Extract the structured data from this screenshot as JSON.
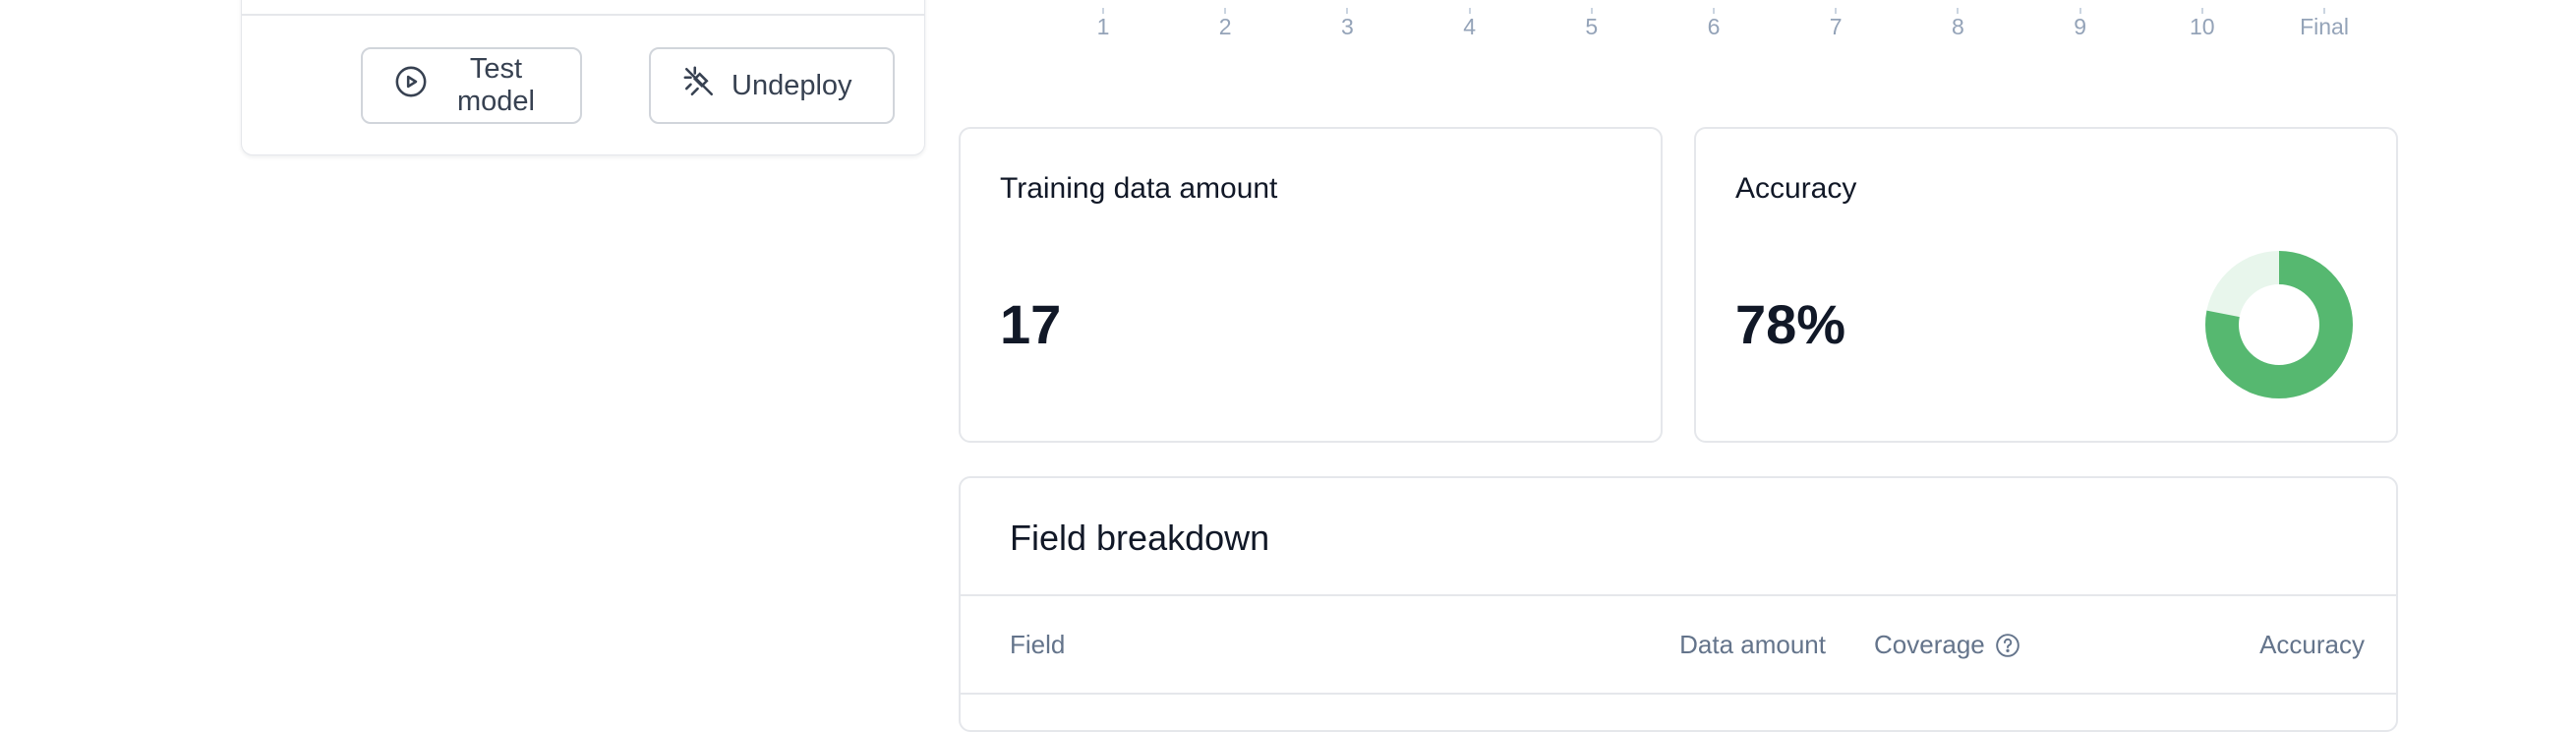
{
  "actions": {
    "test_model_label": "Test model",
    "undeploy_label": "Undeploy"
  },
  "xaxis": {
    "ticks": [
      "1",
      "2",
      "3",
      "4",
      "5",
      "6",
      "7",
      "8",
      "9",
      "10",
      "Final"
    ]
  },
  "stats": {
    "training": {
      "title": "Training data amount",
      "value": "17"
    },
    "accuracy": {
      "title": "Accuracy",
      "value": "78%",
      "fraction": 0.78
    }
  },
  "colors": {
    "accent_green": "#56b870",
    "donut_track": "#e8f6ec"
  },
  "icons": {
    "test_model": "play-circle-icon",
    "undeploy": "unplug-icon",
    "coverage_help": "help-circle-icon"
  },
  "breakdown": {
    "title": "Field breakdown",
    "columns": {
      "field": "Field",
      "data_amount": "Data amount",
      "coverage": "Coverage",
      "accuracy": "Accuracy"
    }
  }
}
